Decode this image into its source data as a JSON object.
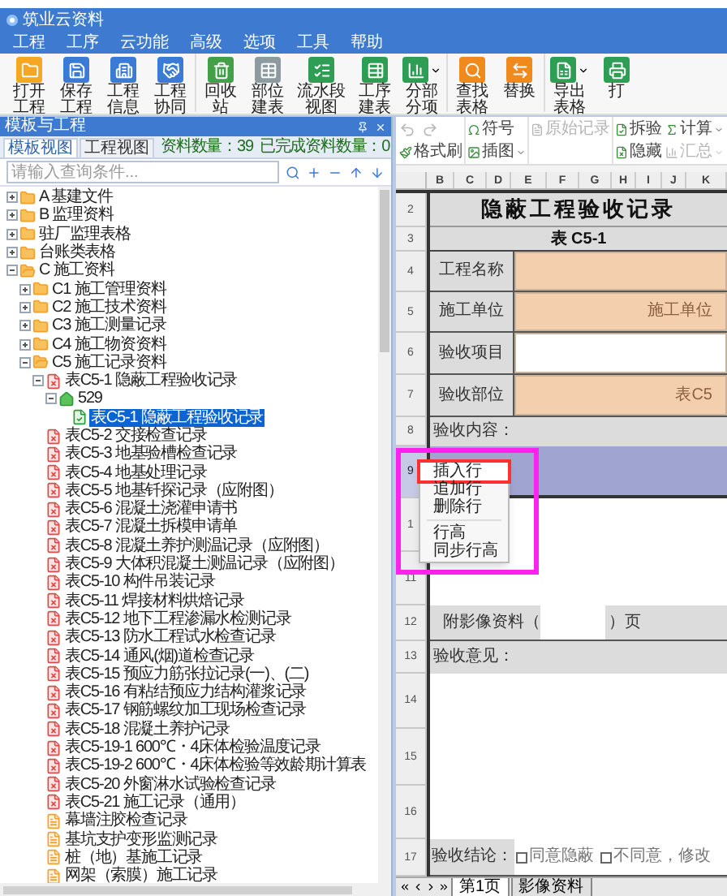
{
  "window": {
    "title": "筑业云资料"
  },
  "menu": [
    "工程",
    "工序",
    "云功能",
    "高级",
    "选项",
    "工具",
    "帮助"
  ],
  "toolbar": {
    "groups": [
      [
        {
          "label": "打开工程",
          "dropdown": false
        },
        {
          "label": "保存工程",
          "dropdown": false
        },
        {
          "label": "工程信息",
          "dropdown": false
        },
        {
          "label": "工程协同",
          "dropdown": false
        }
      ],
      [
        {
          "label": "回收站",
          "dropdown": false
        },
        {
          "label": "部位建表",
          "dropdown": false
        },
        {
          "label": "流水段视图",
          "dropdown": false
        },
        {
          "label": "工序建表",
          "dropdown": false
        },
        {
          "label": "分部分项",
          "dropdown": true
        }
      ],
      [
        {
          "label": "查找表格",
          "dropdown": false
        },
        {
          "label": "替换",
          "dropdown": false
        }
      ],
      [
        {
          "label": "导出表格",
          "dropdown": true
        },
        {
          "label": "打",
          "dropdown": false
        }
      ]
    ]
  },
  "left_panel": {
    "title": "模板与工程",
    "tabs": [
      {
        "label": "模板视图",
        "selected": true
      },
      {
        "label": "工程视图",
        "selected": false
      }
    ],
    "count": "资料数量：39",
    "done_count": "已完成资料数量：0",
    "search": {
      "placeholder": "请输入查询条件..."
    },
    "tree": [
      {
        "label": "A 基建文件",
        "kind": "folder",
        "expanded": false,
        "selected": false
      },
      {
        "label": "B 监理资料",
        "kind": "folder",
        "expanded": false,
        "selected": false
      },
      {
        "label": "驻厂监理表格",
        "kind": "folder",
        "expanded": false,
        "selected": false
      },
      {
        "label": "台账类表格",
        "kind": "folder",
        "expanded": false,
        "selected": false
      },
      {
        "label": "C 施工资料",
        "kind": "folder",
        "expanded": true,
        "selected": false,
        "children": [
          {
            "label": "C1 施工管理资料",
            "kind": "folder",
            "expanded": false,
            "selected": false
          },
          {
            "label": "C2 施工技术资料",
            "kind": "folder",
            "expanded": false,
            "selected": false
          },
          {
            "label": "C3 施工测量记录",
            "kind": "folder",
            "expanded": false,
            "selected": false
          },
          {
            "label": "C4 施工物资资料",
            "kind": "folder",
            "expanded": false,
            "selected": false
          },
          {
            "label": "C5 施工记录资料",
            "kind": "folder",
            "expanded": true,
            "selected": false,
            "children": [
              {
                "label": "表C5-1 隐蔽工程验收记录",
                "kind": "form",
                "expanded": true,
                "selected": false,
                "children": [
                  {
                    "label": "529",
                    "kind": "home",
                    "expanded": true,
                    "selected": false,
                    "children": [
                      {
                        "label": "表C5-1 隐蔽工程验收记录",
                        "kind": "sheet",
                        "selected": true
                      }
                    ]
                  }
                ]
              },
              {
                "label": "表C5-2 交接检查记录",
                "kind": "form",
                "selected": false
              },
              {
                "label": "表C5-3 地基验槽检查记录",
                "kind": "form",
                "selected": false
              },
              {
                "label": "表C5-4 地基处理记录",
                "kind": "form",
                "selected": false
              },
              {
                "label": "表C5-5 地基钎探记录（应附图）",
                "kind": "form",
                "selected": false
              },
              {
                "label": "表C5-6 混凝土浇灌申请书",
                "kind": "form",
                "selected": false
              },
              {
                "label": "表C5-7 混凝土拆模申请单",
                "kind": "form",
                "selected": false
              },
              {
                "label": "表C5-8 混凝土养护测温记录（应附图）",
                "kind": "form",
                "selected": false
              },
              {
                "label": "表C5-9 大体积混凝土测温记录（应附图）",
                "kind": "form",
                "selected": false
              },
              {
                "label": "表C5-10 构件吊装记录",
                "kind": "form",
                "selected": false
              },
              {
                "label": "表C5-11 焊接材料烘焙记录",
                "kind": "form",
                "selected": false
              },
              {
                "label": "表C5-12 地下工程渗漏水检测记录",
                "kind": "form",
                "selected": false
              },
              {
                "label": "表C5-13 防水工程试水检查记录",
                "kind": "form",
                "selected": false
              },
              {
                "label": "表C5-14 通风(烟)道检查记录",
                "kind": "form",
                "selected": false
              },
              {
                "label": "表C5-15 预应力筋张拉记录(一)、(二)",
                "kind": "form",
                "selected": false
              },
              {
                "label": "表C5-16 有粘结预应力结构灌浆记录",
                "kind": "form",
                "selected": false
              },
              {
                "label": "表C5-17 钢筋螺纹加工现场检查记录",
                "kind": "form",
                "selected": false
              },
              {
                "label": "表C5-18 混凝土养护记录",
                "kind": "form",
                "selected": false
              },
              {
                "label": "表C5-19-1 600℃・4床体检验温度记录",
                "kind": "form",
                "selected": false
              },
              {
                "label": "表C5-19-2 600℃・4床体检验等效龄期计算表",
                "kind": "form",
                "selected": false
              },
              {
                "label": "表C5-20 外窗淋水试验检查记录",
                "kind": "form",
                "selected": false
              },
              {
                "label": "表C5-21 施工记录（通用）",
                "kind": "form",
                "selected": false
              },
              {
                "label": "幕墙注胶检查记录",
                "kind": "doc",
                "selected": false
              },
              {
                "label": "基坑支护变形监测记录",
                "kind": "doc",
                "selected": false
              },
              {
                "label": "桩（地）基施工记录",
                "kind": "doc",
                "selected": false
              },
              {
                "label": "网架（索膜）施工记录",
                "kind": "doc",
                "selected": false
              }
            ]
          }
        ]
      }
    ]
  },
  "edit_toolbar": {
    "columns": [
      {
        "top": [
          {
            "kind": "icon_button",
            "disabled": true
          },
          {
            "kind": "icon_button",
            "disabled": true
          }
        ],
        "bottom": [
          {
            "kind": "button",
            "label": "格式刷",
            "disabled": false,
            "dropdown": false
          }
        ]
      },
      {
        "top": [
          {
            "kind": "button",
            "label": "符号",
            "disabled": false,
            "dropdown": false
          }
        ],
        "bottom": [
          {
            "kind": "button",
            "label": "插图",
            "disabled": false,
            "dropdown": true
          }
        ]
      },
      {
        "top": [
          {
            "kind": "button",
            "label": "原始记录",
            "disabled": true,
            "dropdown": false
          }
        ]
      },
      {
        "top": [
          {
            "kind": "button",
            "label": "拆验",
            "disabled": false,
            "dropdown": false
          }
        ],
        "bottom": [
          {
            "kind": "button",
            "label": "隐藏",
            "disabled": false,
            "dropdown": false
          }
        ]
      },
      {
        "top": [
          {
            "kind": "button",
            "label": "计算",
            "disabled": false,
            "dropdown": true
          }
        ],
        "bottom": [
          {
            "kind": "button",
            "label": "汇总",
            "disabled": true,
            "dropdown": true
          }
        ]
      }
    ]
  },
  "sheet": {
    "columns": [
      "B",
      "C",
      "D",
      "E",
      "F",
      "G",
      "H",
      "I",
      "J",
      "K"
    ],
    "rows": [
      {
        "number": "2",
        "kind": "title",
        "selected": false,
        "text": "隐蔽工程验收记录"
      },
      {
        "number": "3",
        "kind": "subtitle",
        "selected": false,
        "text": "表 C5-1"
      },
      {
        "number": "4",
        "kind": "field",
        "selected": false,
        "label": "工程名称",
        "color": "#f4cfae"
      },
      {
        "number": "5",
        "kind": "field",
        "selected": false,
        "label": "施工单位",
        "value": "施工单位",
        "color": "#f4cfae"
      },
      {
        "number": "6",
        "kind": "field",
        "selected": false,
        "label": "验收项目",
        "color": "#ffffff"
      },
      {
        "number": "7",
        "kind": "field",
        "selected": false,
        "label": "验收部位",
        "value": "表C5",
        "color": "#f4cfae"
      },
      {
        "number": "8",
        "kind": "section",
        "selected": false,
        "text": "验收内容："
      },
      {
        "number": "9",
        "kind": "blank",
        "selected": true
      },
      {
        "number": "1",
        "kind": "blank",
        "selected": false
      },
      {
        "number": "11",
        "kind": "blank",
        "selected": false
      },
      {
        "number": "12",
        "kind": "attach",
        "selected": false,
        "label": "附影像资料（",
        "suffix": "）页"
      },
      {
        "number": "13",
        "kind": "section",
        "selected": false,
        "text": "验收意见："
      },
      {
        "number": "14",
        "kind": "blank",
        "selected": false
      },
      {
        "number": "15",
        "kind": "blank",
        "selected": false
      },
      {
        "number": "16",
        "kind": "blank",
        "selected": false
      },
      {
        "number": "17",
        "kind": "result",
        "selected": false,
        "label": "验收结论：",
        "options": [
          {
            "label": "同意隐蔽",
            "checked": false
          },
          {
            "label": "不同意，修改",
            "checked": false
          }
        ]
      }
    ],
    "tabs": [
      {
        "label": "第1页",
        "selected": true
      },
      {
        "label": "影像资料",
        "selected": false
      }
    ]
  },
  "context_menu": {
    "highlight_frame": true,
    "items": [
      {
        "kind": "item",
        "label": "插入行",
        "highlighted": true
      },
      {
        "kind": "item",
        "label": "追加行",
        "highlighted": false
      },
      {
        "kind": "item",
        "label": "删除行",
        "highlighted": false
      },
      {
        "kind": "separator"
      },
      {
        "kind": "item",
        "label": "行高",
        "highlighted": false
      },
      {
        "kind": "item",
        "label": "同步行高",
        "highlighted": false
      }
    ]
  }
}
